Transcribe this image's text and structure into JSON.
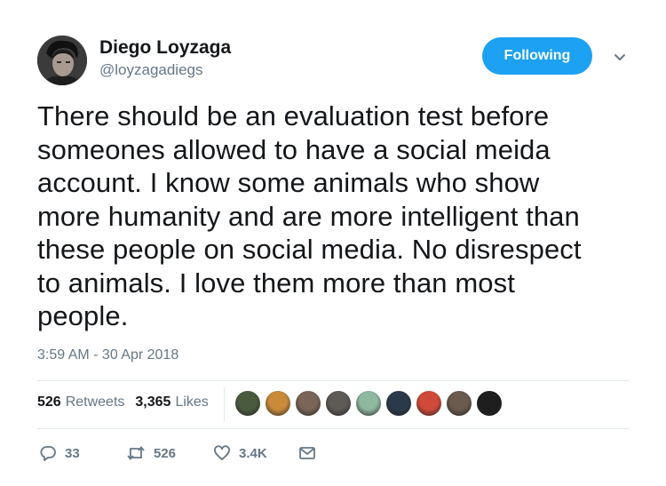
{
  "user": {
    "display_name": "Diego Loyzaga",
    "handle": "@loyzagadiegs"
  },
  "follow_button": {
    "label": "Following",
    "color": "#1da1f2"
  },
  "tweet": {
    "text": "There should be an evaluation test before\nsomeones allowed to have a social meida\naccount. I know some animals who show\nmore humanity and are more intelligent than\nthese people on social media. No disrespect\nto animals. I love them more than most\npeople.",
    "timestamp": "3:59 AM - 30 Apr 2018"
  },
  "stats": {
    "retweets_count": "526",
    "retweets_label": "Retweets",
    "likes_count": "3,365",
    "likes_label": "Likes"
  },
  "likers": [
    {
      "color": "#4a5a3e"
    },
    {
      "color": "#c98a3a"
    },
    {
      "color": "#7a6558"
    },
    {
      "color": "#5e5a56"
    },
    {
      "color": "#8fb8a0"
    },
    {
      "color": "#2b3a4a"
    },
    {
      "color": "#d04a3a"
    },
    {
      "color": "#6b5a4e"
    },
    {
      "color": "#1e1e1e"
    }
  ],
  "actions": {
    "replies": "33",
    "retweets": "526",
    "likes": "3.4K"
  },
  "icons": {
    "reply": "reply-icon",
    "retweet": "retweet-icon",
    "like": "heart-icon",
    "dm": "envelope-icon",
    "caret": "chevron-down-icon"
  }
}
